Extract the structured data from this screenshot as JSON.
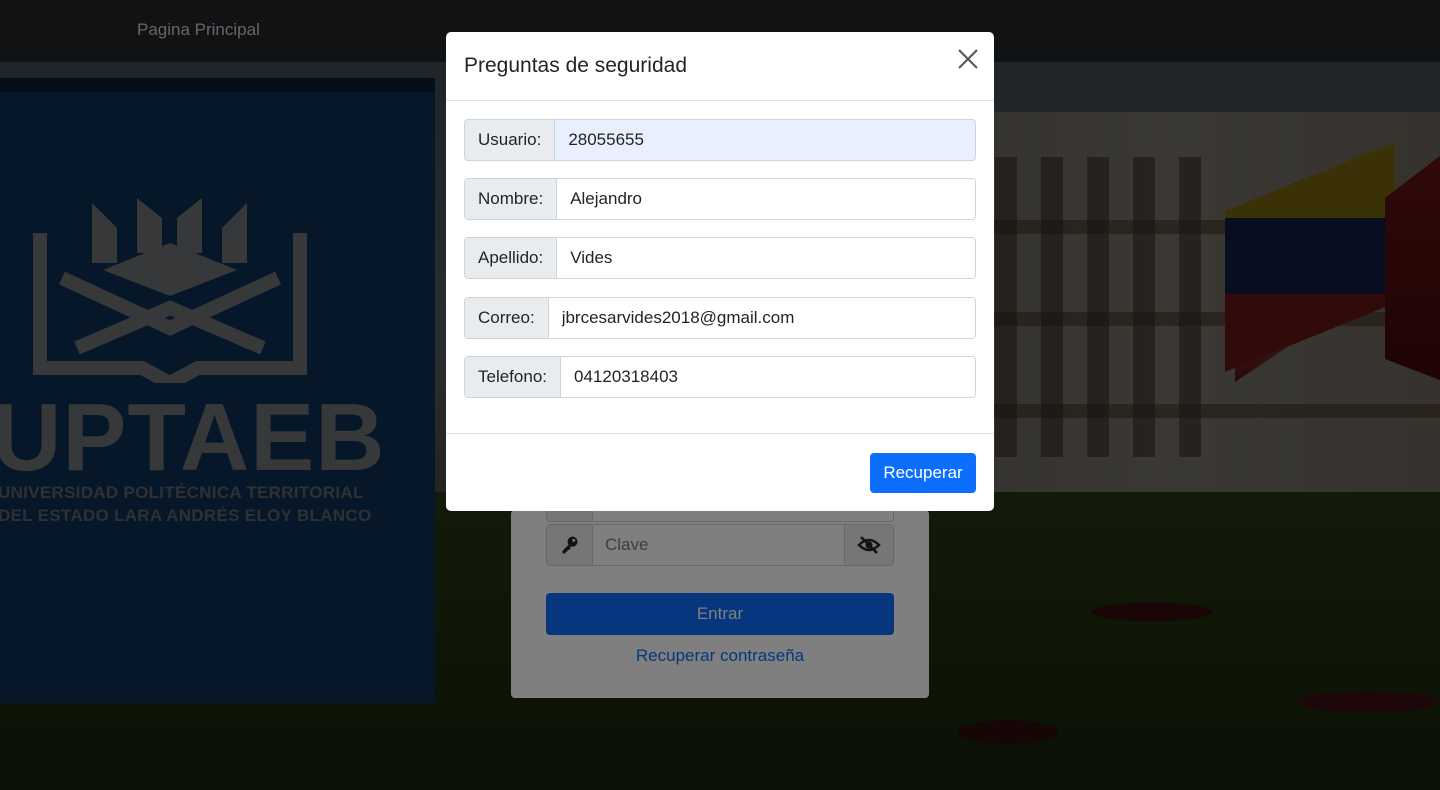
{
  "navbar": {
    "home_link": "Pagina Principal"
  },
  "background": {
    "logo_text": "UPTAEB",
    "university_line1": "UNIVERSIDAD POLITÉCNICA TERRITORIAL",
    "university_line2": "DEL ESTADO LARA ANDRÉS ELOY BLANCO"
  },
  "login": {
    "password_placeholder": "Clave",
    "enter_label": "Entrar",
    "recover_link": "Recuperar contraseña"
  },
  "modal": {
    "title": "Preguntas de seguridad",
    "fields": [
      {
        "label": "Usuario:",
        "value": "28055655"
      },
      {
        "label": "Nombre:",
        "value": "Alejandro"
      },
      {
        "label": "Apellido:",
        "value": "Vides"
      },
      {
        "label": "Correo:",
        "value": "jbrcesarvides2018@gmail.com"
      },
      {
        "label": "Telefono:",
        "value": "04120318403"
      }
    ],
    "submit_label": "Recuperar"
  },
  "icons": [
    "close-icon",
    "key-icon",
    "eye-slash-icon"
  ],
  "colors": {
    "primary": "#0d6efd",
    "navbar": "#212529",
    "banner": "#1c5ea8"
  }
}
